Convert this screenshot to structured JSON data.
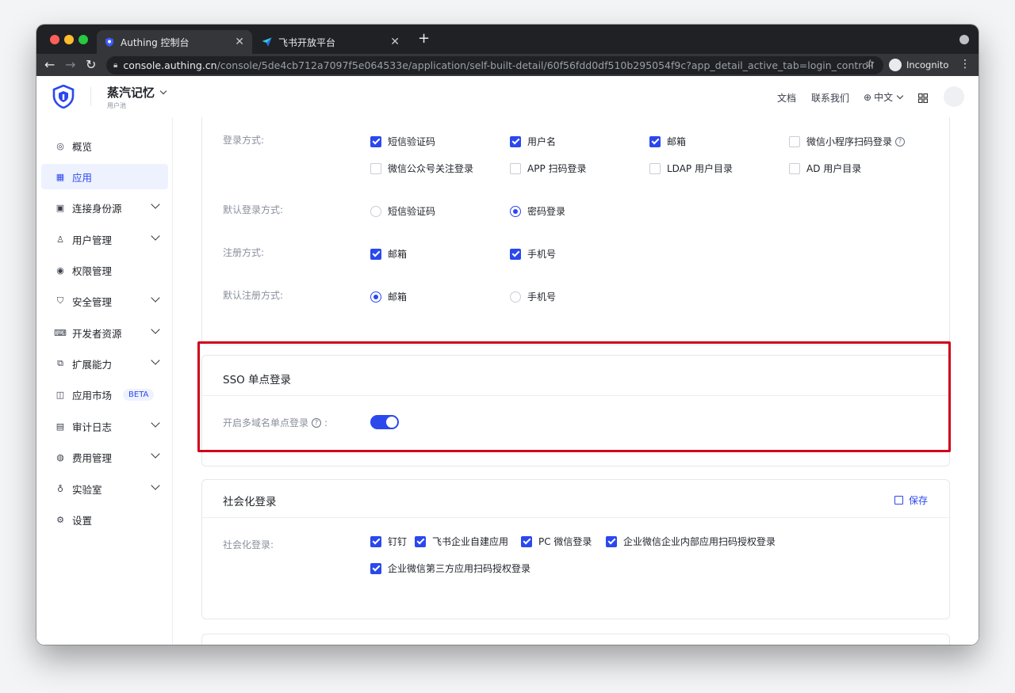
{
  "browser": {
    "tabs": [
      {
        "title": "Authing 控制台",
        "active": true
      },
      {
        "title": "飞书开放平台",
        "active": false
      }
    ],
    "url_host": "console.authing.cn",
    "url_path": "/console/5de4cb712a7097f5e064533e/application/self-built-detail/60f56fdd0df510b295054f9c?app_detail_active_tab=login_controll",
    "profile": "Incognito"
  },
  "header": {
    "org_name": "蒸汽记忆",
    "org_sub": "用户池",
    "docs": "文档",
    "contact": "联系我们",
    "language": "中文"
  },
  "sidebar": {
    "items": [
      {
        "label": "概览",
        "icon": "dashboard-icon"
      },
      {
        "label": "应用",
        "icon": "apps-icon",
        "active": true
      },
      {
        "label": "连接身份源",
        "icon": "identity-icon",
        "expandable": true
      },
      {
        "label": "用户管理",
        "icon": "user-icon",
        "expandable": true
      },
      {
        "label": "权限管理",
        "icon": "permission-icon"
      },
      {
        "label": "安全管理",
        "icon": "shield-icon",
        "expandable": true
      },
      {
        "label": "开发者资源",
        "icon": "code-icon",
        "expandable": true
      },
      {
        "label": "扩展能力",
        "icon": "extension-icon",
        "expandable": true
      },
      {
        "label": "应用市场",
        "icon": "market-icon",
        "badge": "BETA"
      },
      {
        "label": "审计日志",
        "icon": "log-icon",
        "expandable": true
      },
      {
        "label": "费用管理",
        "icon": "billing-icon",
        "expandable": true
      },
      {
        "label": "实验室",
        "icon": "lab-icon",
        "expandable": true
      },
      {
        "label": "设置",
        "icon": "settings-icon"
      }
    ]
  },
  "login_card": {
    "login_methods_label": "登录方式:",
    "login_methods": [
      {
        "label": "短信验证码",
        "checked": true
      },
      {
        "label": "用户名",
        "checked": true
      },
      {
        "label": "邮箱",
        "checked": true
      },
      {
        "label": "微信小程序扫码登录",
        "checked": false
      },
      {
        "label": "微信公众号关注登录",
        "checked": false
      },
      {
        "label": "APP 扫码登录",
        "checked": false
      },
      {
        "label": "LDAP 用户目录",
        "checked": false
      },
      {
        "label": "AD 用户目录",
        "checked": false
      }
    ],
    "default_login_label": "默认登录方式:",
    "default_login": [
      {
        "label": "短信验证码",
        "selected": false
      },
      {
        "label": "密码登录",
        "selected": true
      }
    ],
    "register_label": "注册方式:",
    "register_methods": [
      {
        "label": "邮箱",
        "checked": true
      },
      {
        "label": "手机号",
        "checked": true
      }
    ],
    "default_register_label": "默认注册方式:",
    "default_register": [
      {
        "label": "邮箱",
        "selected": true
      },
      {
        "label": "手机号",
        "selected": false
      }
    ]
  },
  "sso_card": {
    "title": "SSO 单点登录",
    "multi_domain_label": "开启多域名单点登录",
    "label_suffix": ":",
    "enabled": true
  },
  "social_card": {
    "title": "社会化登录",
    "save": "保存",
    "label": "社会化登录:",
    "options": [
      {
        "label": "钉钉",
        "checked": true
      },
      {
        "label": "飞书企业自建应用",
        "checked": true
      },
      {
        "label": "PC 微信登录",
        "checked": true
      },
      {
        "label": "企业微信企业内部应用扫码授权登录",
        "checked": true
      },
      {
        "label": "企业微信第三方应用扫码授权登录",
        "checked": true
      }
    ]
  },
  "colors": {
    "primary": "#2b48ed",
    "highlight": "#d0021b"
  }
}
